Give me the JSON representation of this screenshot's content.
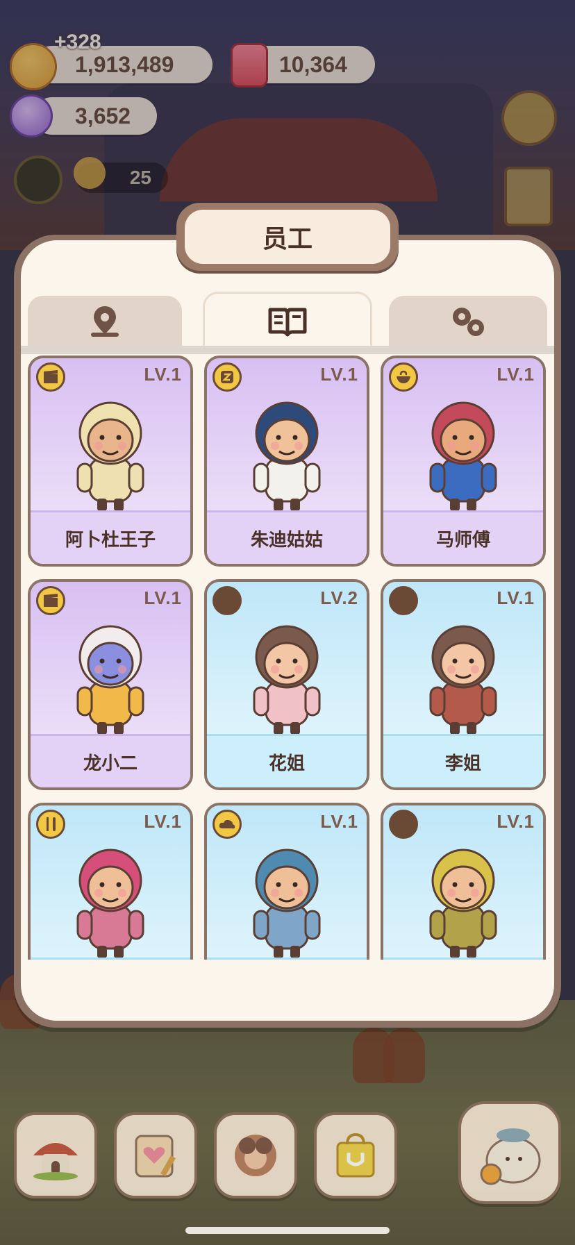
{
  "currency": {
    "coins": "1,913,489",
    "coins_gain": "+328",
    "candles": "10,364",
    "candy": "3,652",
    "level_counter": "25"
  },
  "panel": {
    "title": "员工",
    "tabs": [
      {
        "icon": "map-pin-icon",
        "active": false
      },
      {
        "icon": "book-icon",
        "active": true
      },
      {
        "icon": "gears-icon",
        "active": false
      }
    ]
  },
  "staff": [
    {
      "name": "阿卜杜王子",
      "level": "LV.1",
      "tier": "purple",
      "badge": "clapperboard-icon"
    },
    {
      "name": "朱迪姑姑",
      "level": "LV.1",
      "tier": "purple",
      "badge": "z-icon"
    },
    {
      "name": "马师傅",
      "level": "LV.1",
      "tier": "purple",
      "badge": "bowl-icon"
    },
    {
      "name": "龙小二",
      "level": "LV.1",
      "tier": "purple",
      "badge": "clapperboard-icon"
    },
    {
      "name": "花姐",
      "level": "LV.2",
      "tier": "blue",
      "badge": "empty"
    },
    {
      "name": "李姐",
      "level": "LV.1",
      "tier": "blue",
      "badge": "empty"
    },
    {
      "name": "",
      "level": "LV.1",
      "tier": "blue",
      "badge": "fork-knife-icon"
    },
    {
      "name": "",
      "level": "LV.1",
      "tier": "blue",
      "badge": "cloud-icon"
    },
    {
      "name": "",
      "level": "LV.1",
      "tier": "blue",
      "badge": "empty"
    }
  ],
  "bottom_nav": [
    {
      "icon": "mushroom-house-icon"
    },
    {
      "icon": "notebook-heart-icon"
    },
    {
      "icon": "staff-portrait-icon"
    },
    {
      "icon": "shop-bag-icon"
    },
    {
      "icon": "fish-bun-icon"
    }
  ]
}
